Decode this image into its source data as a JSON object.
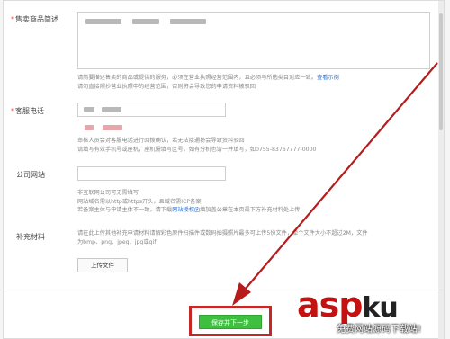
{
  "form": {
    "products": {
      "label": "售卖商品简述",
      "tip_line1": "请简要描述售卖的商品或提供的服务，必须在营业执照经营范围内，且必须与所选类目对应一致。",
      "tip_link": "查看示例",
      "tip_line2": "请勿直接照抄营业执照中的经营范围，否则将会导致您的申请资料被驳回"
    },
    "phone": {
      "label": "客服电话",
      "tip_line1": "审核人员会对客服电话进行回拨确认，若无法接通将会导致资料驳回",
      "tip_line2": "请填写有效手机号或座机，座机需填写区号，如有分机也请一并填写，如0755-83767777-0000"
    },
    "website": {
      "label": "公司网站",
      "tip_line1": "非互联网公司可无需填写",
      "tip_line2": "网站域名需以http或https开头，且域名需ICP备案",
      "tip_line3_a": "若备案主体与申请主体不一致，请下载",
      "tip_line3_link": "网站授权函",
      "tip_line3_b": "填加盖公章在本页最下方补充材料处上传"
    },
    "supplement": {
      "label": "补充材料",
      "tip_line1": "请在此上传其他补充申请材料请解彩色原件扫描件或数码拍摄照片最多可上传5份文件，单个文件大小不超过2M，文件",
      "tip_line2": "为bmp、png、jpeg、jpg或gif",
      "upload_label": "上传文件"
    },
    "save_label": "保存并下一步"
  },
  "watermark": {
    "brand_a": "asp",
    "brand_b": "ku",
    "tagline": "免费网站源码下载站!"
  },
  "colors": {
    "accent_green": "#3fbf3f",
    "highlight_red": "#c62828",
    "link_blue": "#2f6fd6",
    "required_red": "#e53935"
  }
}
